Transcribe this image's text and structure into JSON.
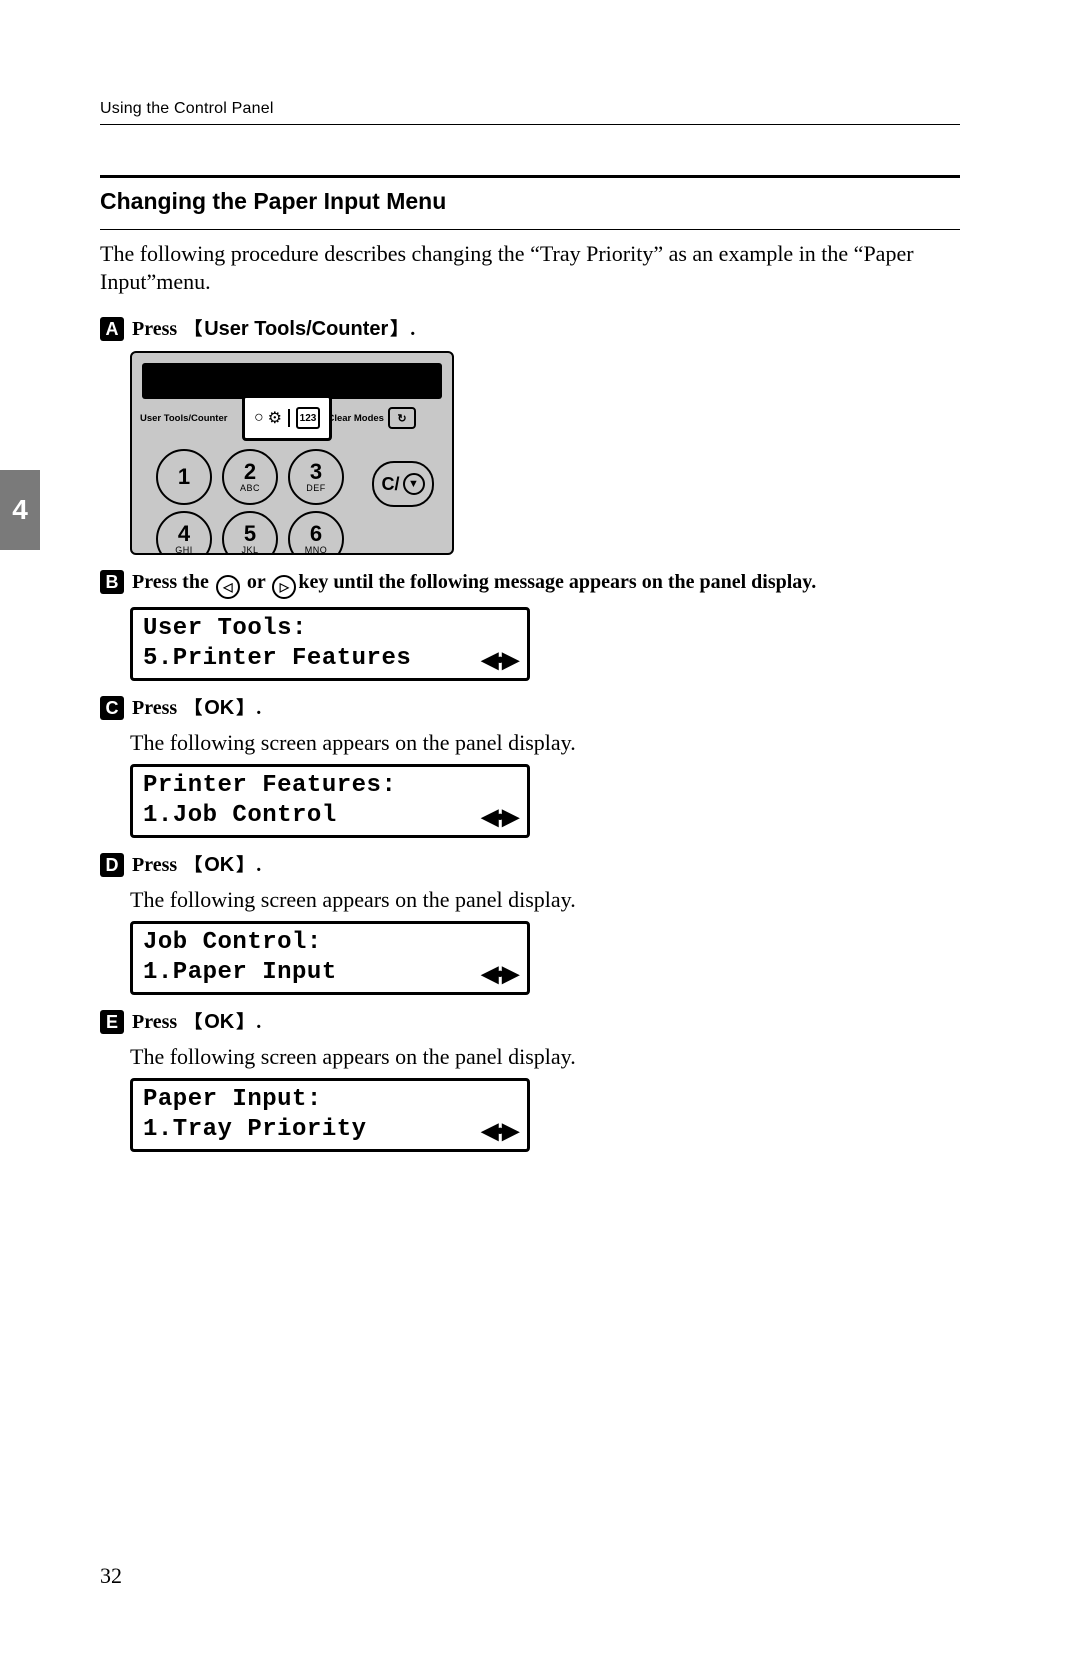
{
  "header": {
    "running_head": "Using the Control Panel"
  },
  "chapter_tab": "4",
  "page_number": "32",
  "section": {
    "title": "Changing the Paper Input Menu",
    "intro": "The following procedure describes changing the “Tray Priority” as an example in the “Paper Input”menu."
  },
  "panel_labels": {
    "user_tools_counter": "User Tools/Counter",
    "clear_modes": "Clear Modes",
    "clear_key": "C/"
  },
  "keypad": [
    {
      "num": "1",
      "sub": ""
    },
    {
      "num": "2",
      "sub": "ABC"
    },
    {
      "num": "3",
      "sub": "DEF"
    },
    {
      "num": "4",
      "sub": "GHI"
    },
    {
      "num": "5",
      "sub": "JKL"
    },
    {
      "num": "6",
      "sub": "MNO"
    }
  ],
  "steps": {
    "s1": {
      "badge": "A",
      "pre": "Press ",
      "btn": "User Tools/Counter",
      "post": ""
    },
    "s2": {
      "badge": "B",
      "pre": "Press the ",
      "mid": " or ",
      "post": "key until the following message appears on the panel display."
    },
    "s3": {
      "badge": "C",
      "pre": "Press ",
      "btn": "OK",
      "post": ""
    },
    "s3_result": "The following screen appears on the panel display.",
    "s4": {
      "badge": "D",
      "pre": "Press ",
      "btn": "OK",
      "post": ""
    },
    "s4_result": "The following screen appears on the panel display.",
    "s5": {
      "badge": "E",
      "pre": "Press ",
      "btn": "OK",
      "post": ""
    },
    "s5_result": "The following screen appears on the panel display."
  },
  "lcd": {
    "l1": {
      "line1": "User Tools:",
      "line2": "5.Printer Features"
    },
    "l2": {
      "line1": "Printer Features:",
      "line2": "1.Job Control"
    },
    "l3": {
      "line1": "Job Control:",
      "line2": "1.Paper Input"
    },
    "l4": {
      "line1": "Paper Input:",
      "line2": "1.Tray Priority"
    }
  },
  "key_glyphs": {
    "left": "◁",
    "right": "▷"
  },
  "brackets": {
    "open": "【",
    "close": "】"
  }
}
